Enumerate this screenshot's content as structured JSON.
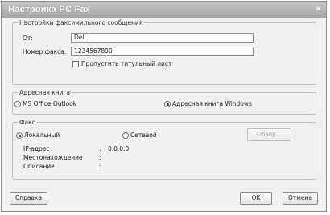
{
  "window": {
    "title": "Настройка PC Fax",
    "close_glyph": "×"
  },
  "fax_settings": {
    "legend": "Настройки факсимильного сообщения",
    "from_label": "От:",
    "from_value": "Dell",
    "fax_number_label": "Номер факса:",
    "fax_number_value": "1234567890",
    "skip_cover_label": "Пропустить титульный лист",
    "skip_cover_checked": false
  },
  "address_book": {
    "legend": "Адресная книга",
    "option_outlook": "MS Office Outlook",
    "option_windows": "Адресная книга Windows",
    "selected": "windows"
  },
  "fax": {
    "legend": "Факс",
    "option_local": "Локальный",
    "option_network": "Сетевой",
    "selected": "local",
    "browse_label": "Обзор...",
    "ip_label": "IP-адрес",
    "ip_sep": ":",
    "ip_value": "0.0.0.0",
    "location_label": "Местонахождение",
    "location_sep": ":",
    "description_label": "Описание",
    "description_sep": ":"
  },
  "buttons": {
    "help": "Справка",
    "ok": "OK",
    "cancel": "Отмена"
  }
}
